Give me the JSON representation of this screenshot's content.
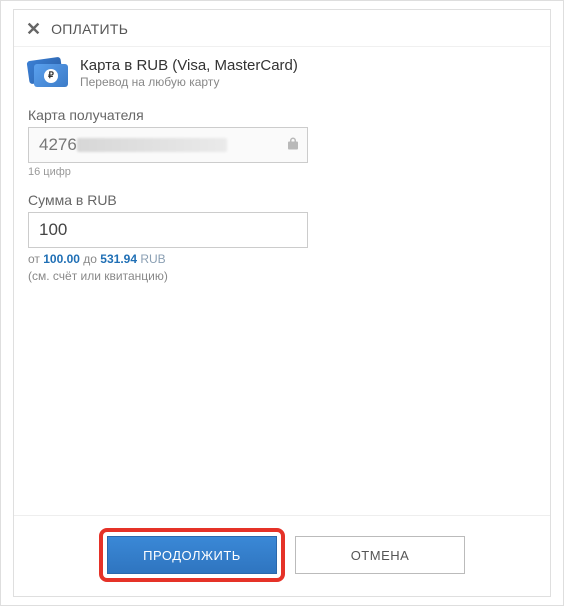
{
  "header": {
    "title": "ОПЛАТИТЬ"
  },
  "method": {
    "title": "Карта в RUB (Visa, MasterCard)",
    "subtitle": "Перевод на любую карту",
    "currency_symbol": "₽"
  },
  "recipient_card": {
    "label": "Карта получателя",
    "value_prefix": "4276",
    "hint": "16 цифр"
  },
  "amount": {
    "label": "Сумма в RUB",
    "value": "100",
    "hint_prefix": "от ",
    "hint_min": "100.00",
    "hint_mid": " до ",
    "hint_max": "531.94",
    "hint_currency": " RUB",
    "hint_note": "(см. счёт или квитанцию)"
  },
  "buttons": {
    "continue": "ПРОДОЛЖИТЬ",
    "cancel": "ОТМЕНА"
  }
}
